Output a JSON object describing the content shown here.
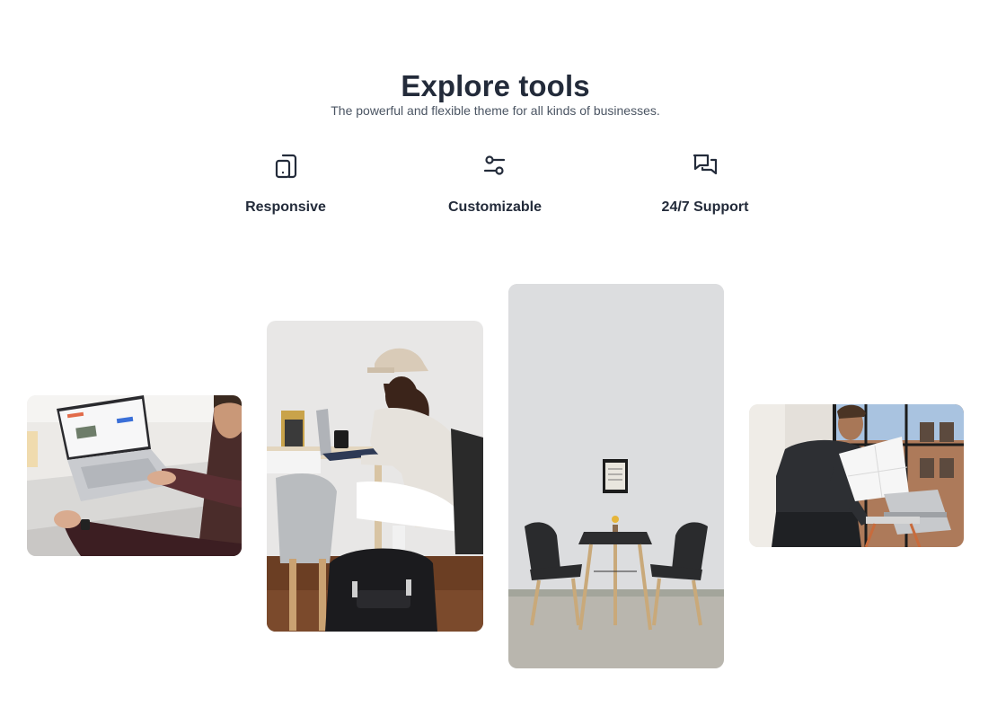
{
  "section": {
    "title": "Explore tools",
    "subtitle": "The powerful and flexible theme for all kinds of businesses."
  },
  "features": [
    {
      "label": "Responsive",
      "icon": "tablet-device-icon"
    },
    {
      "label": "Customizable",
      "icon": "sliders-icon"
    },
    {
      "label": "24/7 Support",
      "icon": "chat-bubbles-icon"
    }
  ],
  "gallery": [
    {
      "name": "laptop-typing-photo"
    },
    {
      "name": "man-working-at-desk-photo"
    },
    {
      "name": "cafe-table-chairs-photo"
    },
    {
      "name": "man-opening-laptop-photo"
    }
  ],
  "colors": {
    "heading": "#232b3a",
    "body_text": "#4b5563",
    "background": "#ffffff"
  }
}
